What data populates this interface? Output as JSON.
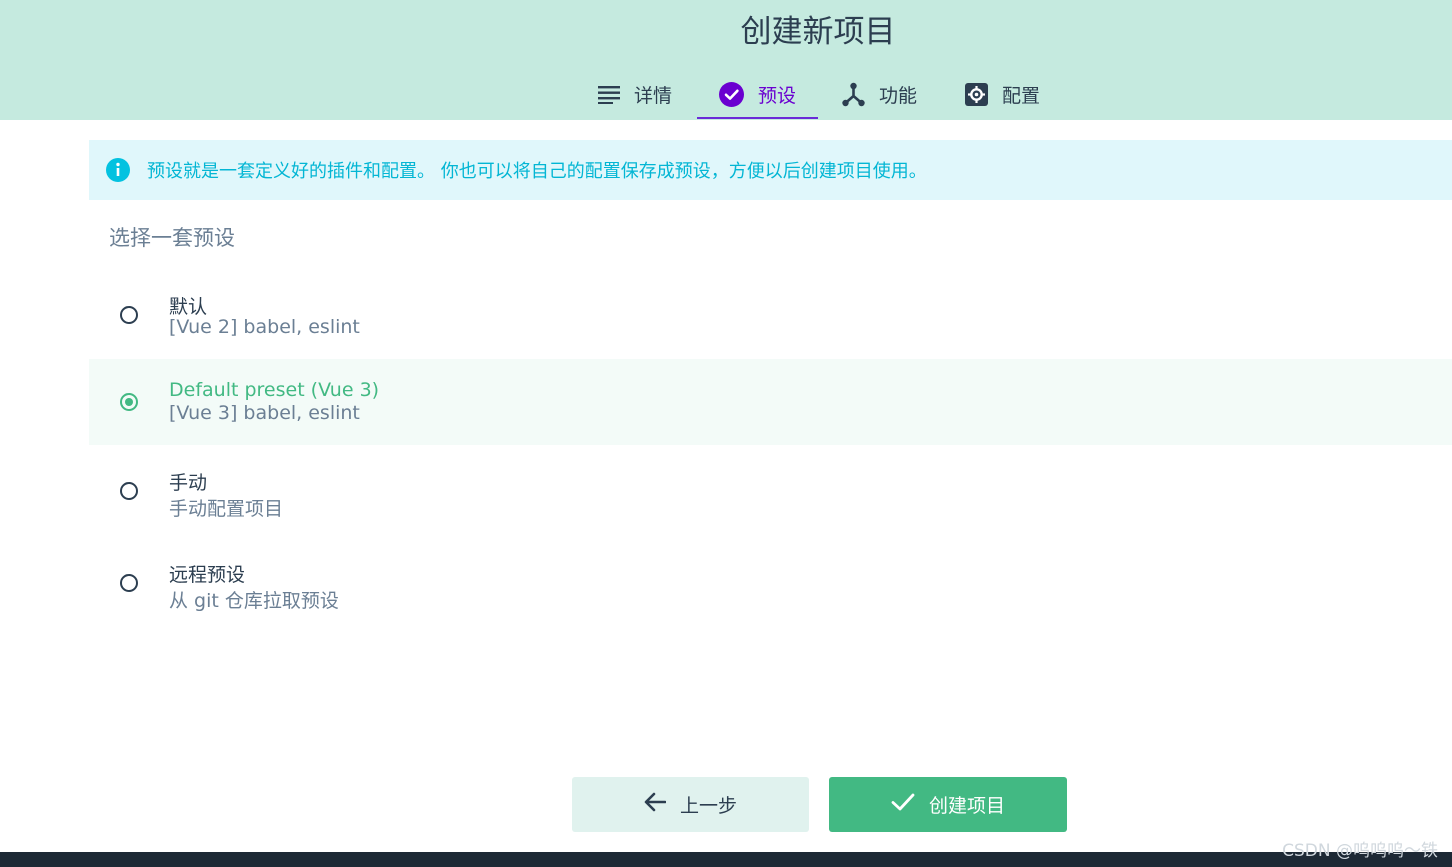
{
  "header": {
    "title": "创建新项目",
    "tabs": [
      {
        "label": "详情",
        "icon": "list-icon"
      },
      {
        "label": "预设",
        "icon": "check-circle-icon",
        "active": true
      },
      {
        "label": "功能",
        "icon": "fork-icon"
      },
      {
        "label": "配置",
        "icon": "gear-icon"
      }
    ]
  },
  "info": {
    "text": "预设就是一套定义好的插件和配置。 你也可以将自己的配置保存成预设，方便以后创建项目使用。",
    "icon": "info-icon"
  },
  "section_title": "选择一套预设",
  "presets": [
    {
      "name": "默认",
      "description": "[Vue 2] babel, eslint",
      "selected": false
    },
    {
      "name": "Default preset (Vue 3)",
      "description": "[Vue 3] babel, eslint",
      "selected": true
    },
    {
      "name": "手动",
      "description": "手动配置项目",
      "selected": false
    },
    {
      "name": "远程预设",
      "description": "从 git 仓库拉取预设",
      "selected": false
    }
  ],
  "buttons": {
    "back_label": "上一步",
    "create_label": "创建项目"
  },
  "watermark": "CSDN @呜呜呜～铁",
  "colors": {
    "header_bg": "#c5eadf",
    "accent_purple": "#6a00d0",
    "accent_green": "#42b983",
    "info_cyan": "#03c2e0"
  }
}
